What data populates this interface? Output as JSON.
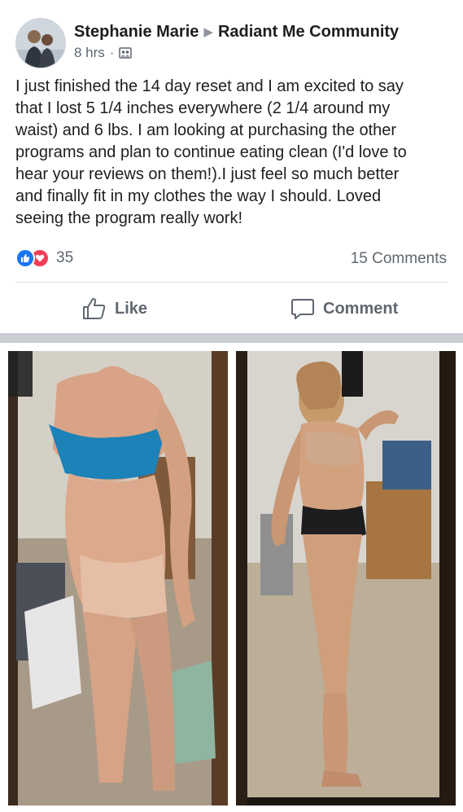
{
  "post": {
    "author": "Stephanie Marie",
    "group": "Radiant Me Community",
    "time": "8 hrs",
    "audience_icon": "group-members-icon",
    "text_lines": [
      "I just finished the 14 day reset and I am excited to say",
      "that I lost 5 1/4 inches everywhere (2 1/4 around my",
      "waist) and 6 lbs. I am looking at purchasing the other",
      "programs and plan to continue eating clean (I'd love to",
      "hear your reviews on them!).I just feel so much better",
      "and finally fit in my clothes the way I should. Loved",
      "seeing the program really work!"
    ]
  },
  "engagement": {
    "reaction_count": "35",
    "comments": "15 Comments",
    "reaction_types": [
      "like",
      "love"
    ]
  },
  "actions": {
    "like_label": "Like",
    "comment_label": "Comment"
  },
  "photos": [
    {
      "name": "before-photo",
      "subject": "mirror selfie, blue sports bra"
    },
    {
      "name": "after-photo",
      "subject": "mirror selfie, side view"
    }
  ],
  "colors": {
    "accent": "#1877f2",
    "love": "#f33e58",
    "secondary_text": "#606770",
    "separator": "#c9ccd1"
  }
}
